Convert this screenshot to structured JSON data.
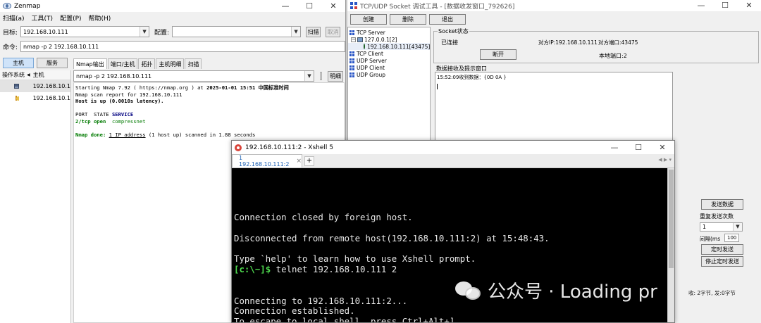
{
  "zenmap": {
    "title": "Zenmap",
    "menu": [
      "扫描(a)",
      "工具(T)",
      "配置(P)",
      "帮助(H)"
    ],
    "target_label": "目标:",
    "target_value": "192.168.10.111",
    "profile_label": "配置:",
    "profile_value": "",
    "scan_button": "扫描",
    "cancel_button": "取消",
    "command_label": "命令:",
    "command_value": "nmap -p 2 192.168.10.111",
    "host_button": "主机",
    "service_button": "服务",
    "os_header": "操作系统",
    "host_header": "主机",
    "hosts": [
      "192.168.10.1",
      "192.168.10.1"
    ],
    "tabs": [
      "Nmap输出",
      "端口/主机",
      "拓扑",
      "主机明细",
      "扫描"
    ],
    "output_select": "nmap -p 2 192.168.10.111",
    "details_button": "明细",
    "output": {
      "l1_pre": "Starting Nmap 7.92 ( ",
      "l1_url": "https://nmap.org",
      "l1_mid": " ) at ",
      "l1_date": "2025-01-01 15:51 中国标准时间",
      "l2": "Nmap scan report for 192.168.10.111",
      "l3": "Host is up (0.0010s latency).",
      "l5_port": "PORT",
      "l5_state": "STATE",
      "l5_service": "SERVICE",
      "l6_port": "2/tcp",
      "l6_state": "open",
      "l6_service": "compressnet",
      "l8_done": "Nmap done:",
      "l8_ip": "1 IP address",
      "l8_rest": " (1 host up) scanned in 1.88 seconds"
    }
  },
  "socket": {
    "title": "TCP/UDP Socket 调试工具 - [数据收发窗口_792626]",
    "toolbar": [
      "创建",
      "删除",
      "退出"
    ],
    "tree": {
      "tcp_server": "TCP Server",
      "server_node": "127.0.0.1[2]",
      "client_node": "192.168.10.111[43475]",
      "tcp_client": "TCP Client",
      "udp_server": "UDP Server",
      "udp_client": "UDP Client",
      "udp_group": "UDP Group"
    },
    "state_group": "Socket状态",
    "status": "已连接",
    "peer_ip": "对方IP:192.168.10.111",
    "peer_port": "对方端口:43475",
    "disconnect_button": "断开",
    "local_port": "本地端口:2",
    "recv_group": "数据接收及提示窗口",
    "recv_line": "15:52:09收到数据：{0D 0A }",
    "send_button": "发送数据",
    "repeat_label": "重复发送次数",
    "repeat_value": "1",
    "interval_label": "间隔(ms",
    "interval_value": "100",
    "timed_send_button": "定时发送",
    "stop_timed_button": "停止定时发送",
    "status_bar": "收: 2字节, 发:0字节"
  },
  "xshell": {
    "title": "192.168.10.111:2 - Xshell 5",
    "tab_label": "1 192.168.10.111:2",
    "tab_close": "×",
    "tab_add": "+",
    "terminal": {
      "blank": "",
      "closed": "Connection closed by foreign host.",
      "disconnected": "Disconnected from remote host(192.168.10.111:2) at 15:48:43.",
      "help": "Type `help' to learn how to use Xshell prompt.",
      "prompt": "[c:\\~]$",
      "cmd": " telnet 192.168.10.111 2",
      "connecting": "Connecting to 192.168.10.111:2...",
      "established": "Connection established.",
      "escape": "To escape to local shell, press Ctrl+Alt+]."
    }
  },
  "watermark": {
    "text": "公众号 · Loading pr"
  },
  "colors": {
    "terminal_bg": "#000000",
    "prompt_yellow": "#f2d04a",
    "prompt_green": "#4fdc4f",
    "nmap_green": "#007a00",
    "nmap_navy": "#000080",
    "selection_blue": "#cfe3f9"
  }
}
